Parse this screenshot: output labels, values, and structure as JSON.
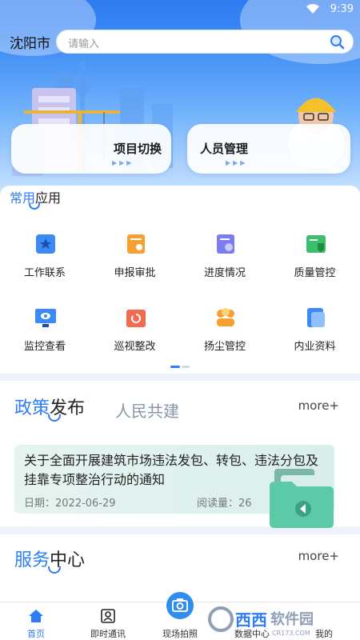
{
  "status_bar": {
    "time": "9:39"
  },
  "header": {
    "city": "沈阳市",
    "search_placeholder": "请输入"
  },
  "quick_cards": [
    {
      "label": "项目切换"
    },
    {
      "label": "人员管理"
    }
  ],
  "common_apps": {
    "title_highlight": "常用",
    "title_rest": "应用",
    "items": [
      {
        "label": "工作联系",
        "icon": "work-contact-icon",
        "color": "#3b8af5"
      },
      {
        "label": "申报审批",
        "icon": "approval-icon",
        "color": "#f5a031"
      },
      {
        "label": "进度情况",
        "icon": "progress-icon",
        "color": "#7a7cf0"
      },
      {
        "label": "质量管控",
        "icon": "quality-icon",
        "color": "#3cbf6a"
      },
      {
        "label": "监控查看",
        "icon": "monitor-icon",
        "color": "#3b8af5"
      },
      {
        "label": "巡视整改",
        "icon": "patrol-icon",
        "color": "#f26a4f"
      },
      {
        "label": "扬尘管控",
        "icon": "dust-icon",
        "color": "#f5a031"
      },
      {
        "label": "内业资料",
        "icon": "documents-icon",
        "color": "#3b8af5"
      }
    ]
  },
  "policy": {
    "tab_active_highlight": "政策",
    "tab_active_rest": "发布",
    "tab_inactive": "人民共建",
    "more": "more+",
    "news": {
      "title": "关于全面开展建筑市场违法发包、转包、违法分包及挂靠专项整治行动的通知",
      "date": "日期：2022-06-29",
      "reads": "阅读量：26"
    }
  },
  "service": {
    "title_highlight": "服务",
    "title_rest": "中心",
    "more": "more+"
  },
  "bottom_nav": [
    {
      "label": "首页",
      "active": true
    },
    {
      "label": "即时通讯"
    },
    {
      "label": "现场拍照"
    },
    {
      "label": "数据中心"
    },
    {
      "label": "我的"
    }
  ],
  "watermark": {
    "brand": "西西",
    "name": "软件园",
    "domain": "CR173.COM"
  },
  "colors": {
    "accent": "#2e7df6",
    "header": "#3b8af5"
  }
}
